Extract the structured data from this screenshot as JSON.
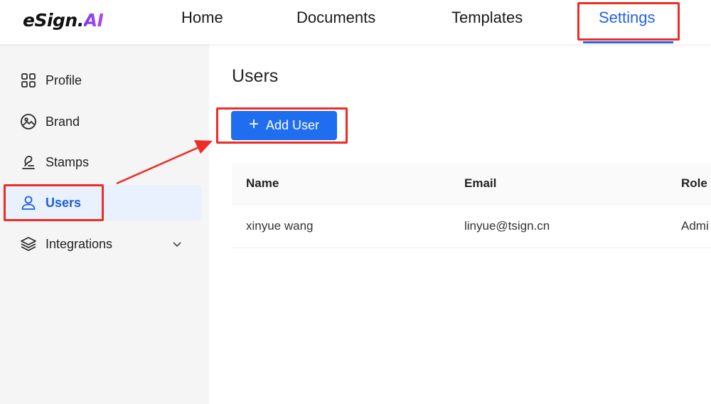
{
  "app": {
    "logo_part1": "eSign",
    "logo_dot": ".",
    "logo_part2": "AI"
  },
  "nav": {
    "items": [
      {
        "label": "Home"
      },
      {
        "label": "Documents"
      },
      {
        "label": "Templates"
      },
      {
        "label": "Settings"
      }
    ],
    "active": "Settings"
  },
  "sidebar": {
    "items": [
      {
        "label": "Profile",
        "icon": "grid-icon"
      },
      {
        "label": "Brand",
        "icon": "image-icon"
      },
      {
        "label": "Stamps",
        "icon": "stamp-icon"
      },
      {
        "label": "Users",
        "icon": "user-icon"
      },
      {
        "label": "Integrations",
        "icon": "layers-icon"
      }
    ],
    "active": "Users"
  },
  "main": {
    "title": "Users",
    "add_button": {
      "icon": "plus-icon",
      "label": "Add User"
    },
    "table": {
      "columns": [
        "Name",
        "Email",
        "Role"
      ],
      "rows": [
        [
          "xinyue wang",
          "linyue@tsign.cn",
          "Admi"
        ]
      ]
    }
  },
  "colors": {
    "accent": "#1f6ef0",
    "nav_active": "#2462e8",
    "sidebar_active_bg": "#e8f1fd",
    "annotation": "#ee2b24"
  }
}
